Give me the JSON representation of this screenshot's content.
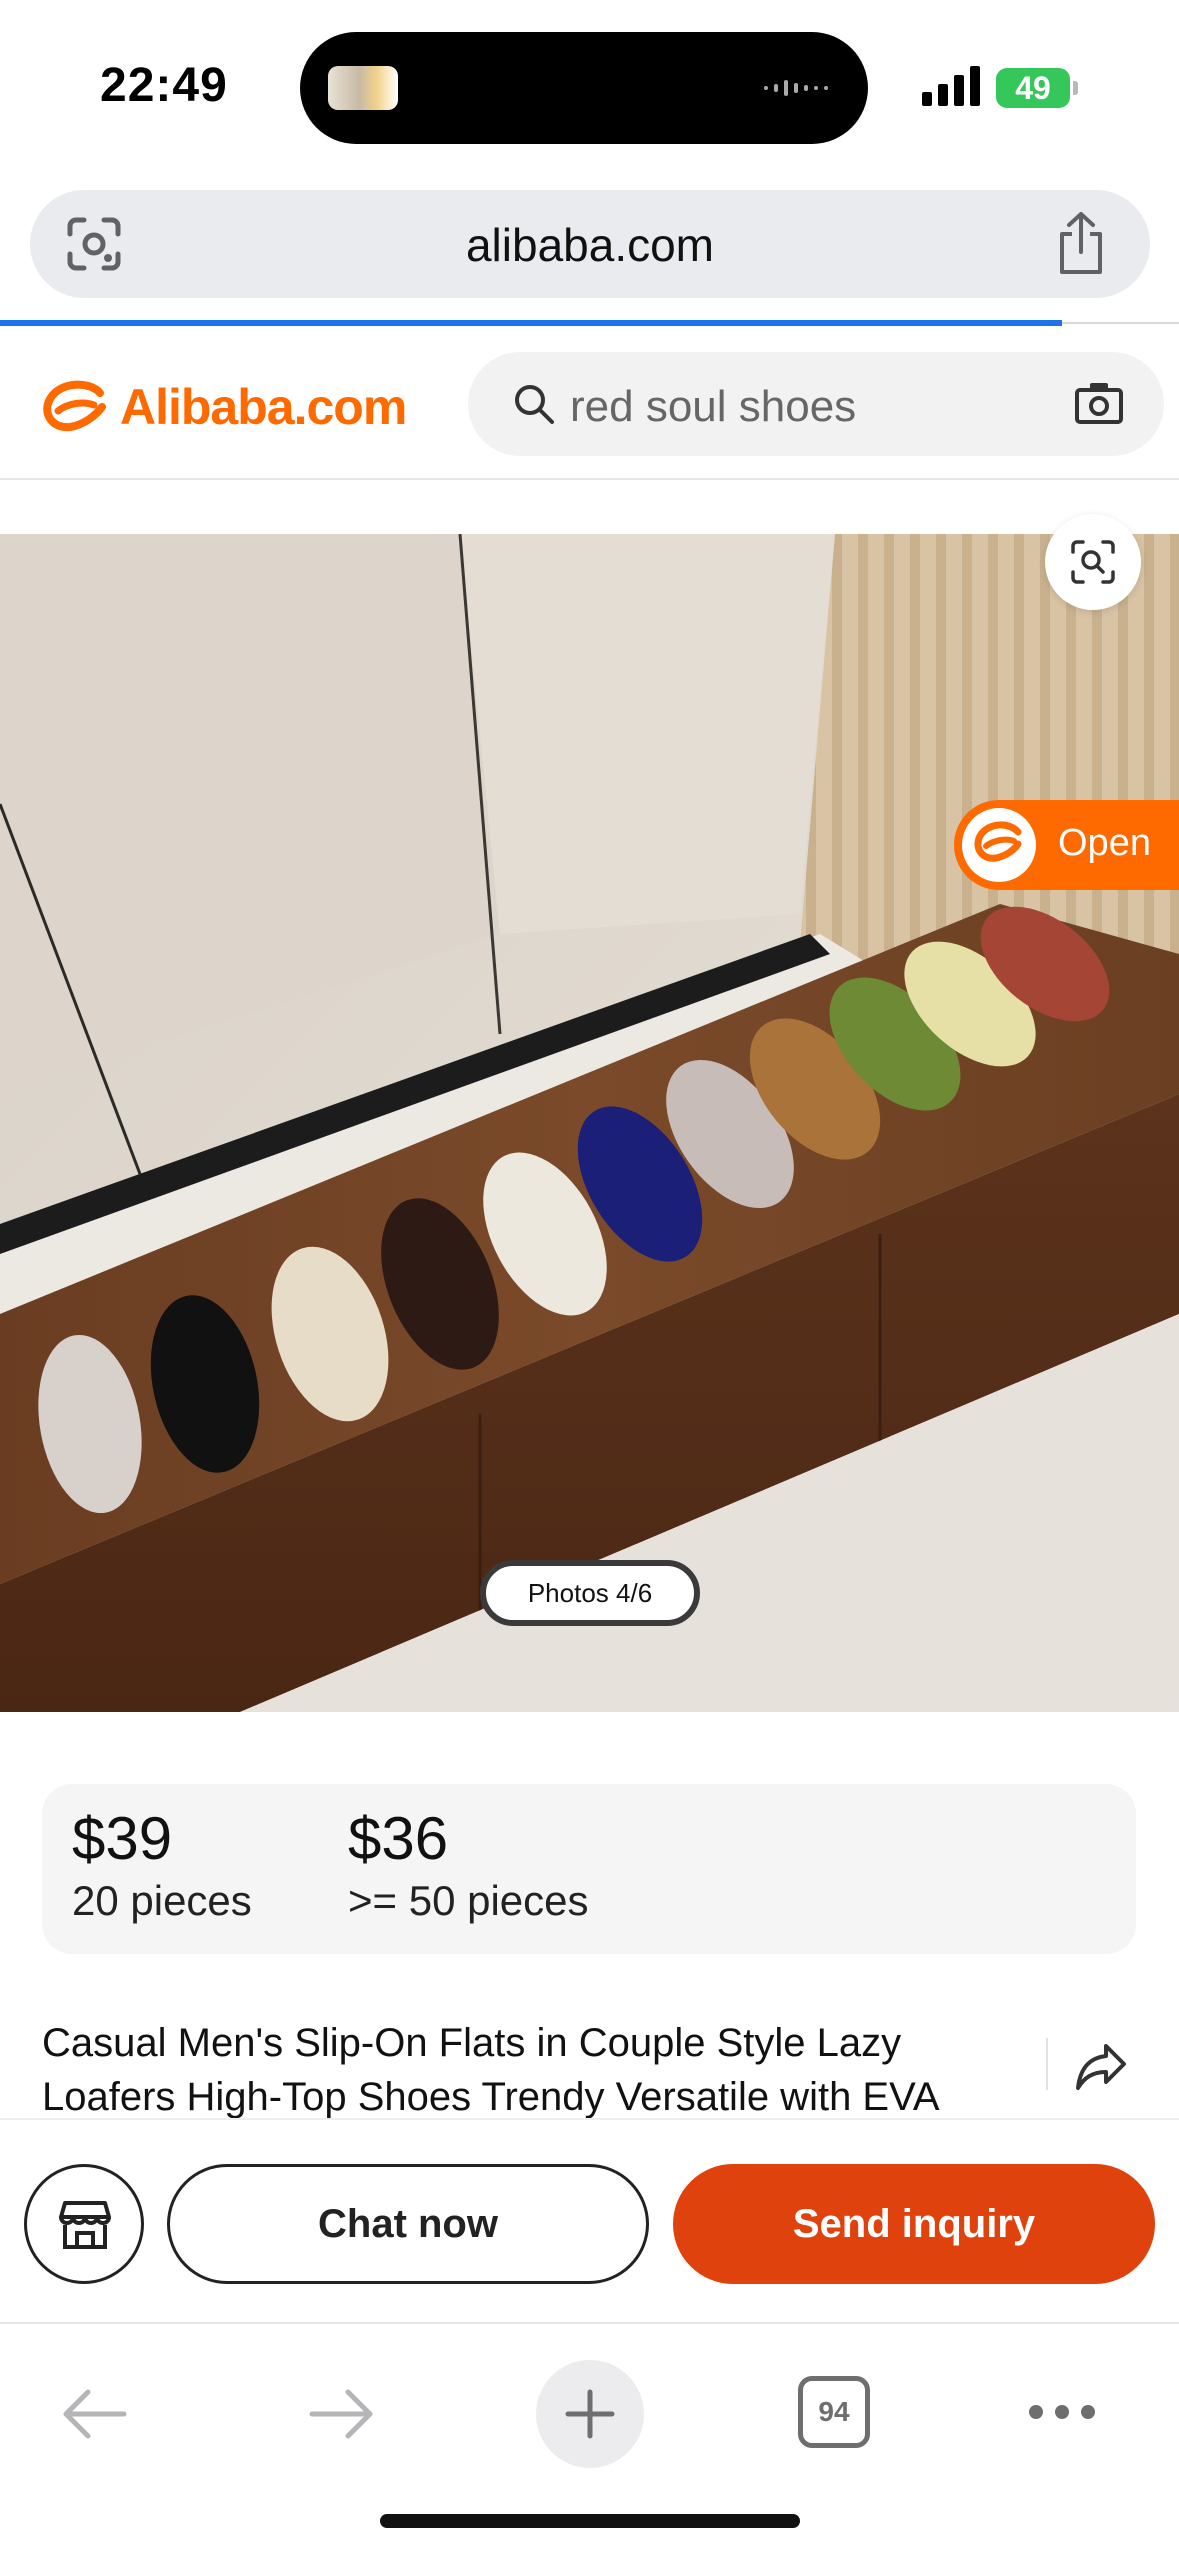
{
  "status_bar": {
    "time": "22:49",
    "battery_level": "49"
  },
  "browser": {
    "url": "alibaba.com",
    "tab_count": "94"
  },
  "site": {
    "brand": "Alibaba.com",
    "search_query": "red soul shoes"
  },
  "gallery": {
    "open_app_label": "Open",
    "photo_counter": "Photos 4/6"
  },
  "pricing": {
    "tiers": [
      {
        "price": "$39",
        "quantity": "20 pieces"
      },
      {
        "price": "$36",
        "quantity": ">= 50 pieces"
      }
    ]
  },
  "product": {
    "title": "Casual Men's Slip-On Flats in Couple Style Lazy Loafers High-Top Shoes Trendy Versatile with EVA"
  },
  "actions": {
    "chat_label": "Chat now",
    "inquiry_label": "Send inquiry"
  },
  "colors": {
    "brand_orange": "#ff6a00",
    "inquiry_button": "#e0420e",
    "progress_blue": "#1a73e8",
    "battery_green": "#35c759"
  },
  "icons": [
    "google-lens-icon",
    "share-icon",
    "search-icon",
    "camera-icon",
    "image-search-icon",
    "alibaba-logo-icon",
    "store-icon",
    "share-arrow-icon",
    "back-arrow-icon",
    "forward-arrow-icon",
    "plus-icon",
    "more-icon"
  ]
}
